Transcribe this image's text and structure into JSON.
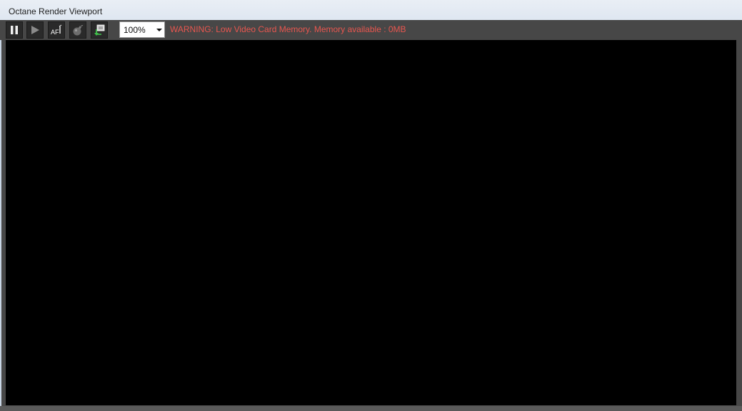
{
  "window": {
    "title": "Octane Render Viewport"
  },
  "toolbar": {
    "buttons": [
      {
        "id": "pause",
        "icon": "pause-icon"
      },
      {
        "id": "play",
        "icon": "play-icon"
      },
      {
        "id": "autofocus",
        "icon": "autofocus-icon",
        "label": "AF"
      },
      {
        "id": "bomb",
        "icon": "bomb-icon"
      },
      {
        "id": "export",
        "icon": "export-icon"
      }
    ],
    "zoom": {
      "value": "100%"
    },
    "warning": "WARNING: Low Video Card Memory. Memory available : 0MB"
  },
  "colors": {
    "toolbar_bg": "#474747",
    "warning_text": "#e8564f",
    "viewport_bg": "#000000"
  }
}
